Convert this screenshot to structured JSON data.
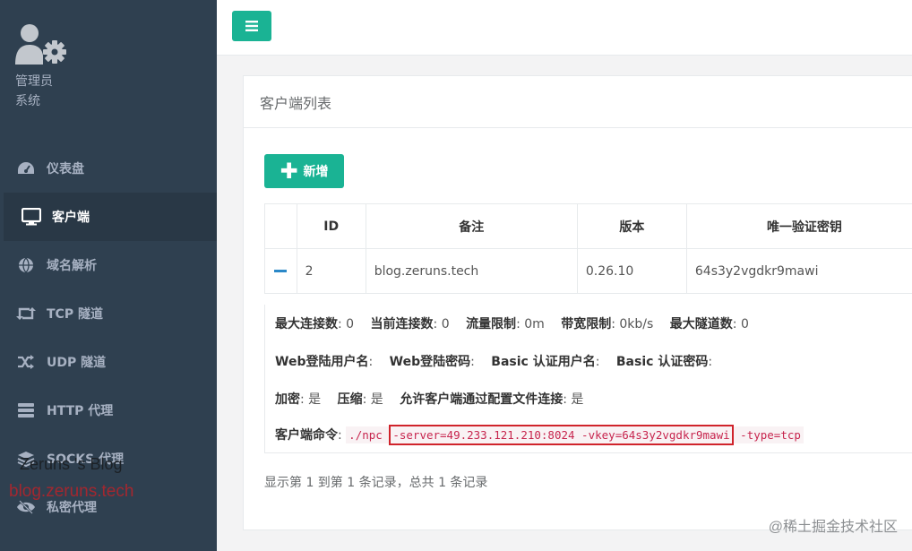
{
  "user": {
    "name": "管理员",
    "role": "系统"
  },
  "nav": [
    {
      "label": "仪表盘",
      "icon": "dashboard-icon",
      "active": false
    },
    {
      "label": "客户端",
      "icon": "monitor-icon",
      "active": true
    },
    {
      "label": "域名解析",
      "icon": "globe-icon",
      "active": false
    },
    {
      "label": "TCP 隧道",
      "icon": "retweet-icon",
      "active": false
    },
    {
      "label": "UDP 隧道",
      "icon": "random-icon",
      "active": false
    },
    {
      "label": "HTTP 代理",
      "icon": "server-icon",
      "active": false
    },
    {
      "label": "SOCKS 代理",
      "icon": "layers-icon",
      "active": false
    },
    {
      "label": "私密代理",
      "icon": "eye-slash-icon",
      "active": false
    }
  ],
  "watermark": {
    "title": "Zeruns 's Blog",
    "url": "blog.zeruns.tech",
    "community": "@稀土掘金技术社区"
  },
  "panel": {
    "title": "客户端列表",
    "add_label": "新增"
  },
  "table": {
    "headers": [
      "ID",
      "备注",
      "版本",
      "唯一验证密钥"
    ],
    "rows": [
      {
        "id": "2",
        "remark": "blog.zeruns.tech",
        "version": "0.26.10",
        "vkey": "64s3y2vgdkr9mawi"
      }
    ]
  },
  "detail": {
    "max_conn_label": "最大连接数",
    "max_conn": ": 0",
    "cur_conn_label": "当前连接数",
    "cur_conn": ": 0",
    "flow_limit_label": "流量限制",
    "flow_limit": ": 0m",
    "rate_limit_label": "带宽限制",
    "rate_limit": ": 0kb/s",
    "max_tunnel_label": "最大隧道数",
    "max_tunnel": ": 0",
    "web_user_label": "Web登陆用户名",
    "web_user": ":",
    "web_pass_label": "Web登陆密码",
    "web_pass": ":",
    "basic_user_label": "Basic 认证用户名",
    "basic_user": ":",
    "basic_pass_label": "Basic 认证密码",
    "basic_pass": ":",
    "crypt_label": "加密",
    "crypt": ": 是",
    "compress_label": "压缩",
    "compress": ": 是",
    "config_conn_label": "允许客户端通过配置文件连接",
    "config_conn": ": 是",
    "cmd_label": "客户端命令",
    "cmd_sep": ":",
    "cmd_prefix": "./npc",
    "cmd_args": "-server=49.233.121.210:8024 -vkey=64s3y2vgdkr9mawi",
    "cmd_suffix": "-type=tcp"
  },
  "pager_info": "显示第 1 到第 1 条记录，总共 1 条记录",
  "colors": {
    "sidebar": "#2f4050",
    "accent": "#1ab394",
    "highlight": "#d0232b"
  }
}
